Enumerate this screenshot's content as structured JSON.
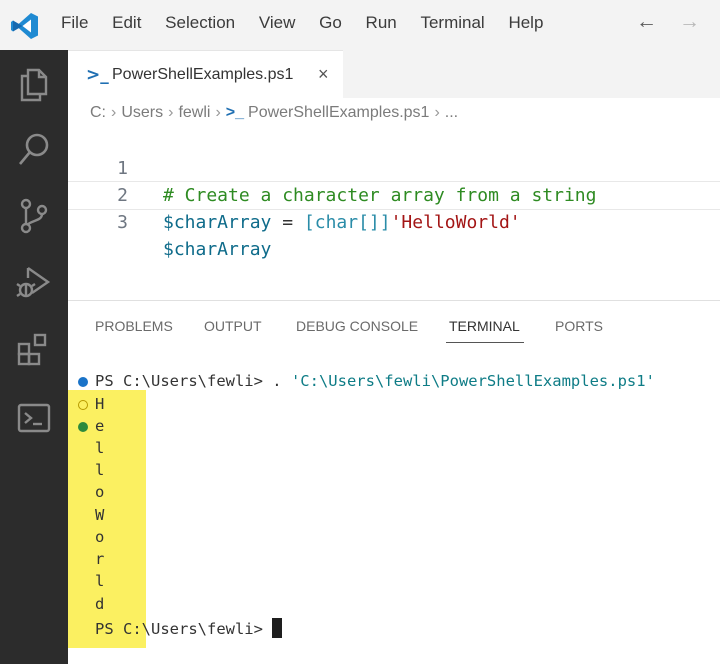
{
  "menubar": {
    "items": [
      "File",
      "Edit",
      "Selection",
      "View",
      "Go",
      "Run",
      "Terminal",
      "Help"
    ]
  },
  "navigation": {
    "back_icon": "arrow-left-icon",
    "forward_icon": "arrow-right-icon"
  },
  "activitybar": {
    "icons": [
      "explorer-icon",
      "search-icon",
      "source-control-icon",
      "run-debug-icon",
      "extensions-icon",
      "terminal-icon"
    ]
  },
  "tab": {
    "label": "PowerShellExamples.ps1",
    "close": "×"
  },
  "breadcrumb": {
    "items": [
      "C:",
      "Users",
      "fewli",
      "PowerShellExamples.ps1",
      "..."
    ]
  },
  "editor": {
    "line_numbers": [
      "1",
      "2",
      "3"
    ],
    "line1": {
      "comment": "# Create a character array from a string"
    },
    "line2": {
      "var": "$charArray",
      "op": " = ",
      "type": "[char[]]",
      "str": "'HelloWorld'"
    },
    "line3": {
      "var": "$charArray"
    }
  },
  "panel": {
    "tabs": [
      "PROBLEMS",
      "OUTPUT",
      "DEBUG CONSOLE",
      "TERMINAL",
      "PORTS"
    ],
    "active_tab": "TERMINAL"
  },
  "terminal": {
    "prompt1": "PS C:\\Users\\fewli> . ",
    "command_path": "'C:\\Users\\fewli\\PowerShellExamples.ps1'",
    "output_chars": [
      "H",
      "e",
      "l",
      "l",
      "o",
      "W",
      "o",
      "r",
      "l",
      "d"
    ],
    "prompt2": "PS C:\\Users\\fewli> "
  },
  "colors": {
    "activitybar": "#2c2c2c",
    "highlight": "#fbf061",
    "accent": "#1a73c8",
    "comment": "#2e8b22",
    "string": "#a31515"
  }
}
